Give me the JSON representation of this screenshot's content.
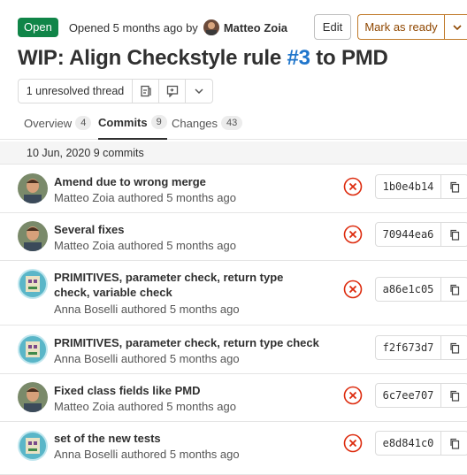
{
  "header": {
    "status": "Open",
    "opened_text": "Opened 5 months ago by",
    "author": "Matteo Zoia",
    "edit_label": "Edit",
    "ready_label": "Mark as ready"
  },
  "title": {
    "prefix": "WIP: Align Checkstyle rule ",
    "issue_ref": "#3",
    "suffix": " to PMD"
  },
  "threads": {
    "label": "1 unresolved thread"
  },
  "tabs": [
    {
      "label": "Overview",
      "count": "4"
    },
    {
      "label": "Commits",
      "count": "9"
    },
    {
      "label": "Changes",
      "count": "43"
    }
  ],
  "date_header": "10 Jun, 2020 9 commits",
  "commits": [
    {
      "title": "Amend due to wrong merge",
      "author": "Matteo Zoia",
      "meta": "authored 5 months ago",
      "sha": "1b0e4b14",
      "failed": true
    },
    {
      "title": "Several fixes",
      "author": "Matteo Zoia",
      "meta": "authored 5 months ago",
      "sha": "70944ea6",
      "failed": true
    },
    {
      "title": "PRIMITIVES, parameter check, return type check, variable check",
      "author": "Anna Boselli",
      "meta": "authored 5 months ago",
      "sha": "a86e1c05",
      "failed": true
    },
    {
      "title": "PRIMITIVES, parameter check, return type check",
      "author": "Anna Boselli",
      "meta": "authored 5 months ago",
      "sha": "f2f673d7",
      "failed": false
    },
    {
      "title": "Fixed class fields like PMD",
      "author": "Matteo Zoia",
      "meta": "authored 5 months ago",
      "sha": "6c7ee707",
      "failed": true
    },
    {
      "title": "set of the new tests",
      "author": "Anna Boselli",
      "meta": "authored 5 months ago",
      "sha": "e8d841c0",
      "failed": true
    }
  ],
  "icons": {
    "status_failed": "status-failed-icon",
    "copy": "copy-icon",
    "chevron": "chevron-down-icon",
    "resolve_thread": "resolve-thread-icon",
    "comment": "comment-icon"
  },
  "colors": {
    "open_badge": "#108548",
    "link": "#1f75cb",
    "failed": "#dd2b0e",
    "ready_border": "#c07a2a"
  }
}
